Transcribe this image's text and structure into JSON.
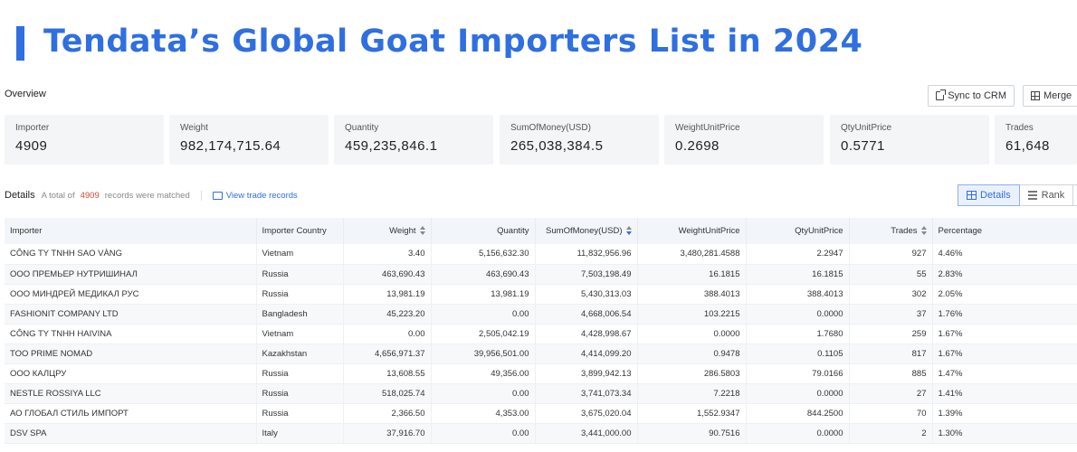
{
  "banner": {
    "title": "Tendata’s Global Goat Importers List in 2024"
  },
  "overview": {
    "label": "Overview",
    "sync_label": "Sync to CRM",
    "merge_label": "Merge",
    "stats": [
      {
        "label": "Importer",
        "value": "4909"
      },
      {
        "label": "Weight",
        "value": "982,174,715.64"
      },
      {
        "label": "Quantity",
        "value": "459,235,846.1"
      },
      {
        "label": "SumOfMoney(USD)",
        "value": "265,038,384.5"
      },
      {
        "label": "WeightUnitPrice",
        "value": "0.2698"
      },
      {
        "label": "QtyUnitPrice",
        "value": "0.5771"
      },
      {
        "label": "Trades",
        "value": "61,648"
      }
    ]
  },
  "details": {
    "title": "Details",
    "total_prefix": "A total of",
    "total_count": "4909",
    "total_suffix": "records were matched",
    "view_link": "View trade records",
    "tab_details": "Details",
    "tab_rank": "Rank"
  },
  "table": {
    "columns": [
      "Importer",
      "Importer Country",
      "Weight",
      "Quantity",
      "SumOfMoney(USD)",
      "WeightUnitPrice",
      "QtyUnitPrice",
      "Trades",
      "Percentage"
    ],
    "rows": [
      [
        "CÔNG TY TNHH SAO VÀNG",
        "Vietnam",
        "3.40",
        "5,156,632.30",
        "11,832,956.96",
        "3,480,281.4588",
        "2.2947",
        "927",
        "4.46%"
      ],
      [
        "ООО ПРЕМЬЕР НУТРИШИНАЛ",
        "Russia",
        "463,690.43",
        "463,690.43",
        "7,503,198.49",
        "16.1815",
        "16.1815",
        "55",
        "2.83%"
      ],
      [
        "ООО МИНДРЕЙ МЕДИКАЛ РУС",
        "Russia",
        "13,981.19",
        "13,981.19",
        "5,430,313.03",
        "388.4013",
        "388.4013",
        "302",
        "2.05%"
      ],
      [
        "FASHIONIT COMPANY LTD",
        "Bangladesh",
        "45,223.20",
        "0.00",
        "4,668,006.54",
        "103.2215",
        "0.0000",
        "37",
        "1.76%"
      ],
      [
        "CÔNG TY TNHH HAIVINA",
        "Vietnam",
        "0.00",
        "2,505,042.19",
        "4,428,998.67",
        "0.0000",
        "1.7680",
        "259",
        "1.67%"
      ],
      [
        "TOO PRIME NOMAD",
        "Kazakhstan",
        "4,656,971.37",
        "39,956,501.00",
        "4,414,099.20",
        "0.9478",
        "0.1105",
        "817",
        "1.67%"
      ],
      [
        "ООО КАЛЦРУ",
        "Russia",
        "13,608.55",
        "49,356.00",
        "3,899,942.13",
        "286.5803",
        "79.0166",
        "885",
        "1.47%"
      ],
      [
        "NESTLE ROSSIYA LLC",
        "Russia",
        "518,025.74",
        "0.00",
        "3,741,073.34",
        "7.2218",
        "0.0000",
        "27",
        "1.41%"
      ],
      [
        "АО ГЛОБАЛ СТИЛЬ ИМПОРТ",
        "Russia",
        "2,366.50",
        "4,353.00",
        "3,675,020.04",
        "1,552.9347",
        "844.2500",
        "70",
        "1.39%"
      ],
      [
        "DSV SPA",
        "Italy",
        "37,916.70",
        "0.00",
        "3,441,000.00",
        "90.7516",
        "0.0000",
        "2",
        "1.30%"
      ]
    ]
  }
}
